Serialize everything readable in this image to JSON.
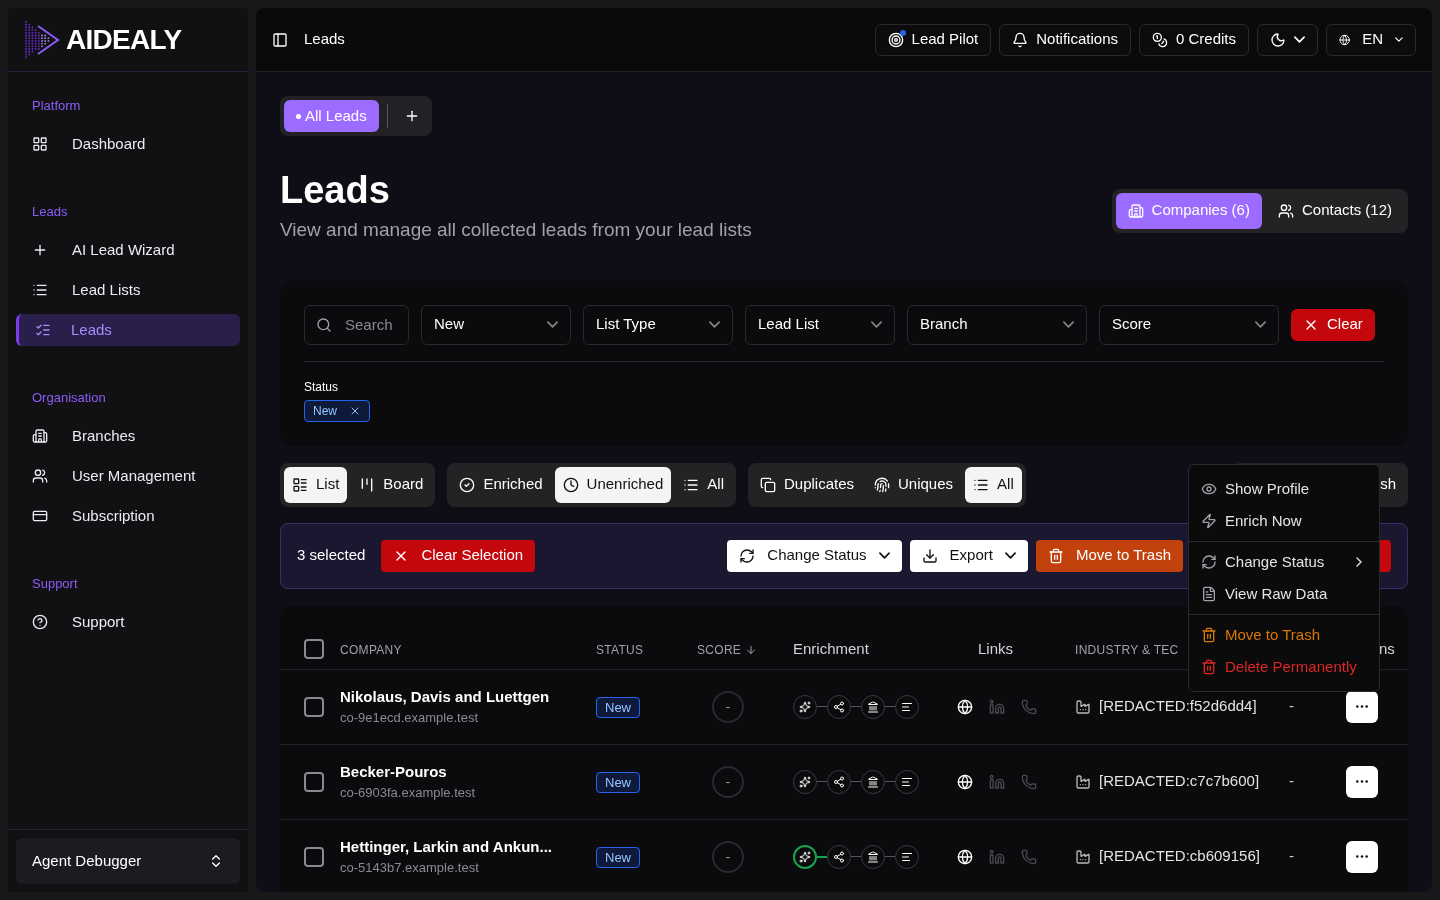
{
  "brand": {
    "name": "AIDEALY"
  },
  "sidebar": {
    "groups": [
      {
        "label": "Platform",
        "items": [
          {
            "label": "Dashboard",
            "selected": false
          }
        ]
      },
      {
        "label": "Leads",
        "items": [
          {
            "label": "AI Lead Wizard",
            "selected": false
          },
          {
            "label": "Lead Lists",
            "selected": false
          },
          {
            "label": "Leads",
            "selected": true
          }
        ]
      },
      {
        "label": "Organisation",
        "items": [
          {
            "label": "Branches",
            "selected": false
          },
          {
            "label": "User Management",
            "selected": false
          },
          {
            "label": "Subscription",
            "selected": false
          }
        ]
      },
      {
        "label": "Support",
        "items": [
          {
            "label": "Support",
            "selected": false
          }
        ]
      }
    ],
    "footer": {
      "label": "Agent Debugger"
    }
  },
  "header": {
    "breadcrumb": "Leads",
    "buttons": [
      {
        "label": "Lead Pilot",
        "indicator": true
      },
      {
        "label": "Notifications",
        "indicator": false
      },
      {
        "label": "0 Credits",
        "indicator": false
      }
    ],
    "language": {
      "label": "EN"
    }
  },
  "view_tabs": [
    {
      "label": "All Leads",
      "selected": true
    }
  ],
  "page": {
    "title": "Leads",
    "subtitle": "View and manage all collected leads from your lead lists"
  },
  "entity_toggle": [
    {
      "label": "Companies (6)",
      "selected": true
    },
    {
      "label": "Contacts (12)",
      "selected": false
    }
  ],
  "filters": {
    "search_placeholder": "Search",
    "selects": [
      "New",
      "List Type",
      "Lead List",
      "Branch",
      "Score"
    ],
    "clear": "Clear",
    "status_label": "Status",
    "status_chips": [
      "New"
    ]
  },
  "segment_groups": [
    [
      {
        "label": "List",
        "selected": true
      },
      {
        "label": "Board",
        "selected": false
      }
    ],
    [
      {
        "label": "Enriched",
        "selected": false
      },
      {
        "label": "Unenriched",
        "selected": true
      },
      {
        "label": "All",
        "selected": false
      }
    ],
    [
      {
        "label": "Duplicates",
        "selected": false
      },
      {
        "label": "Uniques",
        "selected": false
      },
      {
        "label": "All",
        "selected": true
      }
    ]
  ],
  "trash_toggle": {
    "visible_text": "sh"
  },
  "bulk_bar": {
    "count": "3 selected",
    "clear": "Clear Selection",
    "actions": [
      {
        "label": "Change Status",
        "kind": "dropdown"
      },
      {
        "label": "Export",
        "kind": "dropdown"
      },
      {
        "label": "Move to Trash",
        "kind": "warning"
      },
      {
        "kind": "danger"
      }
    ]
  },
  "table": {
    "all_checked": false,
    "columns": [
      {
        "label": "COMPANY",
        "sorted": false
      },
      {
        "label": "STATUS",
        "sorted": false
      },
      {
        "label": "SCORE",
        "sorted": true
      },
      {
        "label": "Enrichment",
        "sorted": false
      },
      {
        "label": "Links",
        "sorted": false
      },
      {
        "label": "INDUSTRY & TEC",
        "sorted": false
      },
      {
        "label": "ns",
        "sorted": false
      }
    ],
    "rows": [
      {
        "checked": false,
        "name": "Nikolaus, Davis and Luettgen",
        "domain": "co-9e1ecd.example.test",
        "status": "New",
        "score": "-",
        "enrichment": [
          false,
          false,
          false,
          false
        ],
        "links": {
          "website": true,
          "linkedin": false,
          "phone": false
        },
        "industry": "[REDACTED:f52d6dd4]",
        "column_7": "-"
      },
      {
        "checked": false,
        "name": "Becker-Pouros",
        "domain": "co-6903fa.example.test",
        "status": "New",
        "score": "-",
        "enrichment": [
          false,
          false,
          false,
          false
        ],
        "links": {
          "website": true,
          "linkedin": false,
          "phone": false
        },
        "industry": "[REDACTED:c7c7b600]",
        "column_7": "-"
      },
      {
        "checked": false,
        "name": "Hettinger, Larkin and Ankun...",
        "domain": "co-5143b7.example.test",
        "status": "New",
        "score": "-",
        "enrichment": [
          true,
          false,
          false,
          false
        ],
        "links": {
          "website": true,
          "linkedin": false,
          "phone": false
        },
        "industry": "[REDACTED:cb609156]",
        "column_7": "-"
      }
    ]
  },
  "context_menu": {
    "sections": [
      [
        {
          "label": "Show Profile",
          "kind": "normal",
          "submenu": false
        },
        {
          "label": "Enrich Now",
          "kind": "normal",
          "submenu": false
        }
      ],
      [
        {
          "label": "Change Status",
          "kind": "normal",
          "submenu": true
        },
        {
          "label": "View Raw Data",
          "kind": "normal",
          "submenu": false
        }
      ],
      [
        {
          "label": "Move to Trash",
          "kind": "warning",
          "submenu": false
        },
        {
          "label": "Delete Permanently",
          "kind": "danger",
          "submenu": false
        }
      ]
    ]
  }
}
